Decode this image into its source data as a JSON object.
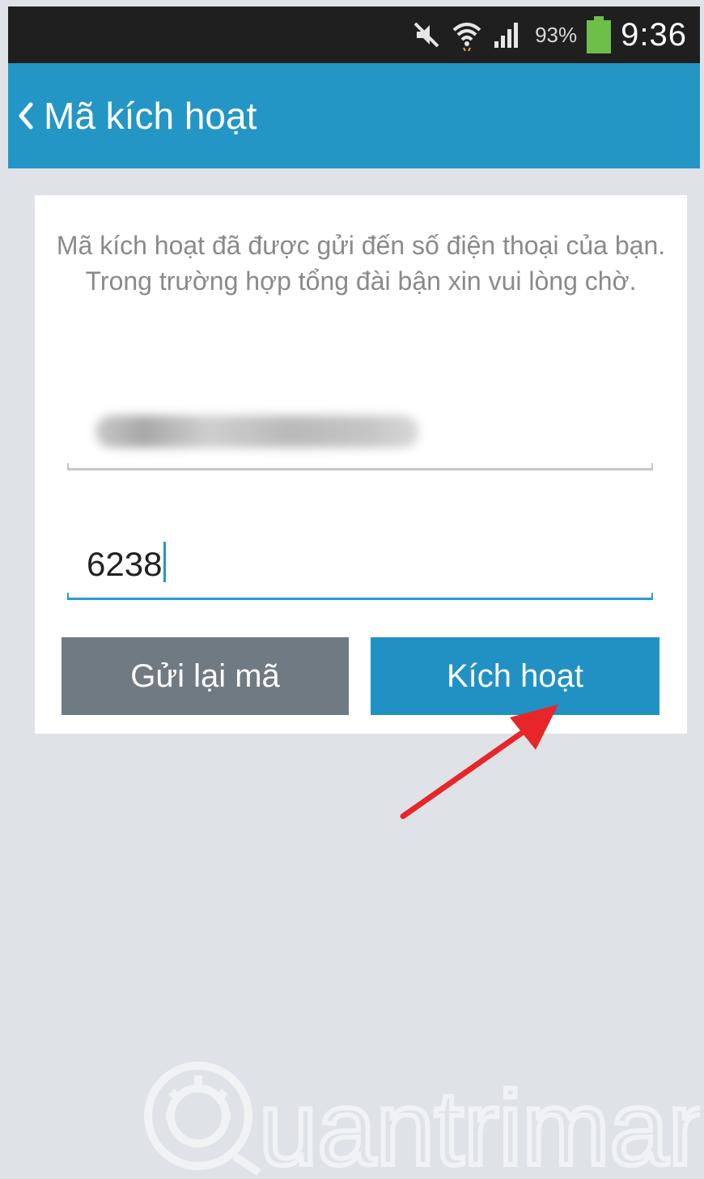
{
  "status_bar": {
    "battery_percent": "93%",
    "time": "9:36",
    "icons": [
      "mute-icon",
      "wifi-icon",
      "signal-icon",
      "battery-icon"
    ]
  },
  "app_bar": {
    "back_icon": "chevron-left-icon",
    "title": "Mã kích hoạt",
    "color": "#2496c6"
  },
  "form": {
    "message": "Mã kích hoạt đã được gửi đến số điện thoại của bạn. Trong trường hợp tổng đài bận xin vui lòng chờ.",
    "code_value": "6238"
  },
  "buttons": {
    "resend_label": "Gửi lại mã",
    "activate_label": "Kích hoạt"
  },
  "annotation": {
    "arrow_color": "#e8262a"
  },
  "watermark": {
    "text": "uantrimang"
  }
}
